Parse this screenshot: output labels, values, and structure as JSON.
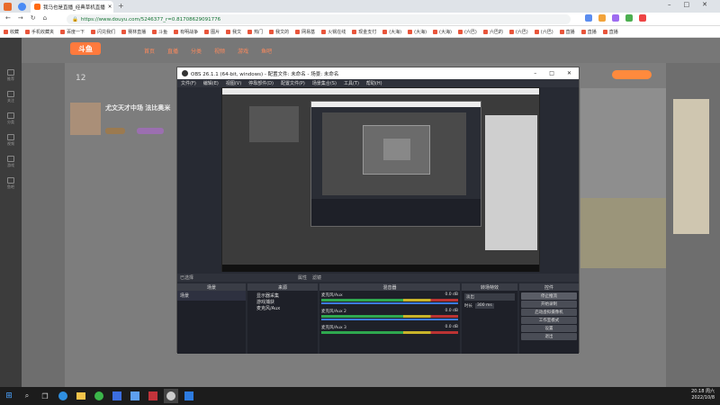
{
  "browser": {
    "tab_title": "我马也是直播_经典草机直播",
    "url": "https://www.douyu.com/5246377_r=0.81708629091776",
    "bookmarks": [
      "收藏",
      "手机收藏夹",
      "百度一下",
      "闪兑我们",
      "赛林直播",
      "斗鱼",
      "有明战争",
      "图片",
      "我文",
      "热门",
      "我文的",
      "网易基",
      "火锅在线",
      "现金支付",
      "(大海)",
      "(大海)",
      "(大海)",
      "(六巴)",
      "六巴的",
      "(六巴)",
      "(六巴)",
      "直播",
      "直播",
      "直播"
    ]
  },
  "page": {
    "logo": "斗鱼",
    "nav": [
      "首页",
      "直播",
      "分类",
      "视频",
      "游戏",
      "鱼吧"
    ],
    "counter": "12",
    "room_title": "尤文天才中场 法比奥米",
    "sidebar": [
      "推荐",
      "关注",
      "分类",
      "视频",
      "游戏",
      "鱼吧"
    ]
  },
  "obs": {
    "title": "OBS 26.1.1 (64-bit, windows) - 配置文件: 未命名 - 场景: 未命名",
    "menu": [
      "文件(F)",
      "编辑(E)",
      "视图(V)",
      "停靠部件(D)",
      "配置文件(P)",
      "场景集合(S)",
      "工具(T)",
      "帮助(H)"
    ],
    "panel_labels": [
      "已选择",
      "属性",
      "滤镜"
    ],
    "docks": {
      "scenes": {
        "header": "场景",
        "items": [
          "场景"
        ]
      },
      "sources": {
        "header": "来源",
        "items": [
          "显示器采集",
          "游戏捕获",
          "麦克风/Aux"
        ]
      },
      "mixer": {
        "header": "混音器",
        "channels": [
          {
            "name": "麦克风/Aux",
            "db": "0.0 dB"
          },
          {
            "name": "麦克风/Aux 2",
            "db": "0.0 dB"
          },
          {
            "name": "麦克风/Aux 3",
            "db": "0.0 dB"
          }
        ]
      },
      "transitions": {
        "header": "转场特效",
        "type": "淡出",
        "duration_label": "时长",
        "duration": "300 ms"
      },
      "controls": {
        "header": "控件",
        "buttons": [
          "停止推流",
          "开始录制",
          "启动虚拟摄像机",
          "工作室模式",
          "设置",
          "退出"
        ]
      }
    }
  },
  "taskbar": {
    "time": "20:18 周六",
    "date": "2022/10/8"
  }
}
